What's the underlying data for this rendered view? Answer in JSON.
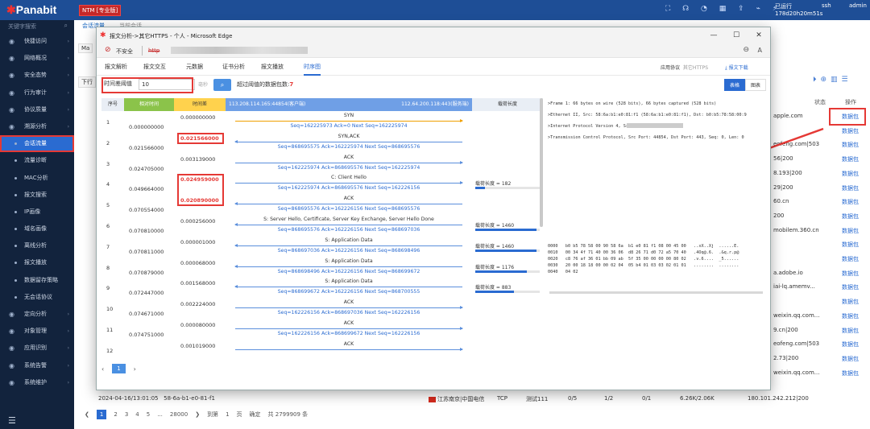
{
  "app": {
    "brand": "Panabit",
    "edition": "NTM [专业版]"
  },
  "topbar": {
    "uptime_label": "已运行",
    "uptime_value": "178d20h20m51s",
    "ssh": "ssh",
    "user": "admin"
  },
  "sidebar": {
    "search_placeholder": "关键字搜索",
    "items": [
      {
        "label": "快捷访问",
        "icon": "heart-icon"
      },
      {
        "label": "网络概况",
        "icon": "monitor-icon"
      },
      {
        "label": "安全态势",
        "icon": "globe-icon"
      },
      {
        "label": "行为审计",
        "icon": "flag-icon"
      },
      {
        "label": "协议质量",
        "icon": "chart-icon"
      },
      {
        "label": "溯源分析",
        "icon": "trace-icon"
      },
      {
        "label": "会话流量",
        "sub": true,
        "active": true
      },
      {
        "label": "流量诊断",
        "sub": true
      },
      {
        "label": "MAC分析",
        "sub": true
      },
      {
        "label": "报文搜索",
        "sub": true
      },
      {
        "label": "IP画像",
        "sub": true
      },
      {
        "label": "域名画像",
        "sub": true
      },
      {
        "label": "离线分析",
        "sub": true
      },
      {
        "label": "报文播放",
        "sub": true
      },
      {
        "label": "数据留存策略",
        "sub": true
      },
      {
        "label": "无会话协议",
        "sub": true
      },
      {
        "label": "定向分析",
        "icon": "target-icon"
      },
      {
        "label": "对象管理",
        "icon": "object-icon"
      },
      {
        "label": "应用识别",
        "icon": "app-icon"
      },
      {
        "label": "系统告警",
        "icon": "bell-icon"
      },
      {
        "label": "系统维护",
        "icon": "gear-icon"
      }
    ]
  },
  "background": {
    "tabs": [
      "会话流量",
      "当前会话"
    ],
    "side_buttons": [
      "Ma",
      "下行"
    ],
    "col_status": "状态",
    "col_action": "操作",
    "link_text": "数据包",
    "cells": [
      "apple.com",
      "",
      "eofeng.com|503",
      "56|200",
      "8.193|200",
      "29|200",
      "60.cn",
      "200",
      "mobilem.360.cn",
      "",
      "",
      "a.adobe.io",
      "iai-lq.amemv...",
      "",
      "weixin.qq.com...",
      "9.cn|200",
      "eofeng.com|503",
      "2.73|200",
      "weixin.qq.com..."
    ],
    "bottom_row": {
      "time": "2024-04-16/13:01:05",
      "mac": "58-6a-b1-e0-81-f1",
      "loc": "江苏南京|中国电信",
      "proto": "TCP",
      "app": "测试111",
      "c1": "0/5",
      "c2": "1/2",
      "c3": "0/1",
      "rate": "6.26K/2.06K",
      "dst": "180.101.242.212|200"
    },
    "pagination": {
      "pages": [
        "1",
        "2",
        "3",
        "4",
        "5",
        "...",
        "28000"
      ],
      "goto_label": "到第",
      "goto_value": "1",
      "page_label": "页",
      "confirm": "确定",
      "total": "共 2799909 条"
    }
  },
  "window": {
    "title": "报文分析->其它HTTPS - 个人 - Microsoft Edge",
    "address_warning": "不安全",
    "address_url": "http"
  },
  "analysis": {
    "tabs": [
      "报文解析",
      "报文交互",
      "元数据",
      "证书分析",
      "报文播放",
      "时序图"
    ],
    "active_tab": "时序图",
    "protocol_label": "应用协议",
    "protocol_value": "其它HTTPS",
    "download": "报文下载",
    "threshold_label": "时间差阈值",
    "threshold_value": "10",
    "threshold_unit": "毫秒",
    "count_text": "超过阈值的数据包数:",
    "count_value": "7",
    "view_table": "表格",
    "view_chart": "图表",
    "columns": {
      "no": "序号",
      "rel_time": "相对时间",
      "delta": "时间差",
      "client": "113.208.114.165:44854(客户端)",
      "server": "112.64.200.118:443(服务端)",
      "payload": "载荷长度"
    },
    "rows": [
      {
        "no": "1",
        "rel": "0.000000000",
        "delta": "0.000000000",
        "hl": false
      },
      {
        "no": "2",
        "rel": "0.021566000",
        "delta": "0.021566000",
        "hl": true
      },
      {
        "no": "3",
        "rel": "0.024705000",
        "delta": "0.003139000",
        "hl": false
      },
      {
        "no": "4",
        "rel": "0.049664000",
        "delta": "0.024959000",
        "hl": true
      },
      {
        "no": "5",
        "rel": "0.070554000",
        "delta": "0.020890000",
        "hl": true
      },
      {
        "no": "6",
        "rel": "0.070810000",
        "delta": "0.000256000",
        "hl": false
      },
      {
        "no": "7",
        "rel": "0.070811000",
        "delta": "0.000001000",
        "hl": false
      },
      {
        "no": "8",
        "rel": "0.070879000",
        "delta": "0.000068000",
        "hl": false
      },
      {
        "no": "9",
        "rel": "0.072447000",
        "delta": "0.001568000",
        "hl": false
      },
      {
        "no": "10",
        "rel": "0.074671000",
        "delta": "0.002224000",
        "hl": false
      },
      {
        "no": "11",
        "rel": "0.074751000",
        "delta": "0.000080000",
        "hl": false
      },
      {
        "no": "12",
        "rel": "",
        "delta": "0.001019000",
        "hl": false
      }
    ],
    "messages": [
      {
        "label": "SYN",
        "seq": "Seq=162225973   Ack=0   Next Seq=162225974",
        "dir": "r",
        "color": "y"
      },
      {
        "label": "SYN,ACK",
        "seq": "Seq=868695575   Ack=162225974   Next Seq=868695576",
        "dir": "l"
      },
      {
        "label": "ACK",
        "seq": "Seq=162225974   Ack=868695576   Next Seq=162225974",
        "dir": "r"
      },
      {
        "label": "C:  Client Hello",
        "seq": "Seq=162225974   Ack=868695576   Next Seq=162226156",
        "dir": "r"
      },
      {
        "label": "ACK",
        "seq": "Seq=868695576   Ack=162226156   Next Seq=868695576",
        "dir": "l"
      },
      {
        "label": "S:  Server Hello, Certificate, Server Key Exchange, Server Hello Done",
        "seq": "Seq=868695576   Ack=162226156   Next Seq=868697036",
        "dir": "l"
      },
      {
        "label": "S:  Application Data",
        "seq": "Seq=868697036   Ack=162226156   Next Seq=868698496",
        "dir": "l"
      },
      {
        "label": "S:  Application Data",
        "seq": "Seq=868698496   Ack=162226156   Next Seq=868699672",
        "dir": "l"
      },
      {
        "label": "S:  Application Data",
        "seq": "Seq=868699672   Ack=162226156   Next Seq=868700555",
        "dir": "l"
      },
      {
        "label": "ACK",
        "seq": "Seq=162226156   Ack=868697036   Next Seq=162226156",
        "dir": "r"
      },
      {
        "label": "ACK",
        "seq": "Seq=162226156   Ack=868699672   Next Seq=162226156",
        "dir": "r"
      },
      {
        "label": "ACK",
        "seq": "",
        "dir": "r"
      }
    ],
    "payloads": [
      {
        "row": 3,
        "text": "载荷长度 = 182",
        "frac": 0.15
      },
      {
        "row": 5,
        "text": "载荷长度 = 1460",
        "frac": 0.95
      },
      {
        "row": 6,
        "text": "载荷长度 = 1460",
        "frac": 0.95
      },
      {
        "row": 7,
        "text": "载荷长度 = 1176",
        "frac": 0.8
      },
      {
        "row": 8,
        "text": "载荷长度 = 883",
        "frac": 0.6
      }
    ],
    "details": [
      ">Frame 1: 66 bytes on wire (528 bits), 66 bytes captured (528 bits)",
      ">Ethernet II, Src: 58:6a:b1:e0:81:f1 (58:6a:b1:e0:81:f1), Dst: b0:b5:78:58:00:9",
      ">Internet Protocol Version 4, Src: ",
      ">Transmission Control Protocol, Src Port: 44854, Dst Port: 443, Seq: 0, Len: 0"
    ],
    "hex": [
      "0000   b0 b5 78 58 00 90 58 6a  b1 e0 81 f1 08 00 45 00   ..xX..Xj  ......E.",
      "0010   00 34 4f 71 40 00 36 06  d8 26 71 d0 72 a5 70 40   .4Oq@.6.  .&q.r.p@",
      "0020   c8 76 af 36 01 bb 09 ab  5f 35 00 00 00 00 80 02   .v.6....  _5......",
      "0030   20 00 18 18 00 00 02 04  05 b4 01 03 03 02 01 01   ........  ........",
      "0040   04 02"
    ],
    "pagination": {
      "current": "1"
    }
  }
}
